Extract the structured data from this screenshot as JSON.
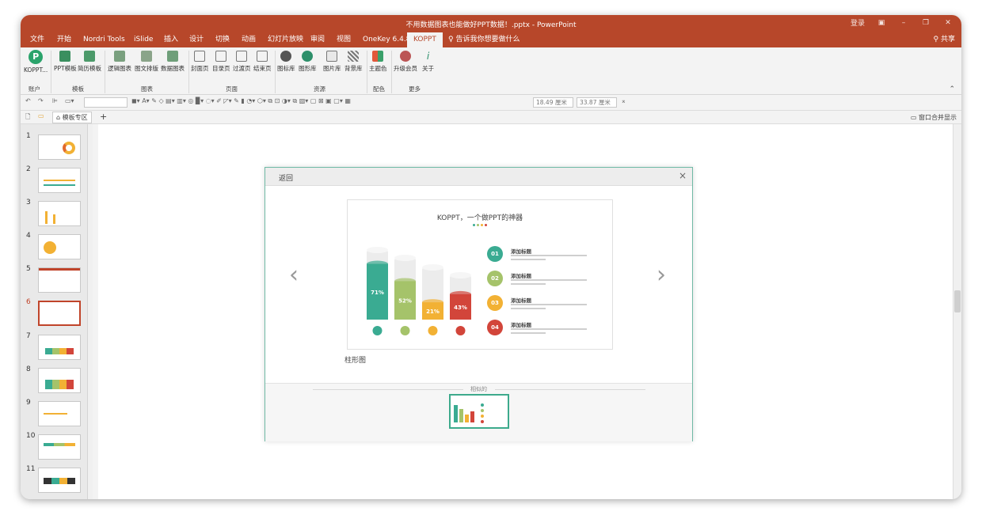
{
  "window": {
    "title": "不用数据图表也能做好PPT数据！.pptx - PowerPoint",
    "signin": "登录",
    "share": "共享"
  },
  "tabs": [
    {
      "label": "文件"
    },
    {
      "label": "开始"
    },
    {
      "label": "Nordri Tools"
    },
    {
      "label": "iSlide"
    },
    {
      "label": "插入"
    },
    {
      "label": "设计"
    },
    {
      "label": "切换"
    },
    {
      "label": "动画"
    },
    {
      "label": "幻灯片放映"
    },
    {
      "label": "审阅"
    },
    {
      "label": "视图"
    },
    {
      "label": "OneKey 6.4.8"
    },
    {
      "label": "KOPPT"
    }
  ],
  "tell_me": "告诉我你想要做什么",
  "ribbon": {
    "buttons": [
      "KOPPT...",
      "PPT模板",
      "简历模板",
      "逻辑图表",
      "图文排版",
      "数据图表",
      "封面页",
      "目录页",
      "过渡页",
      "结束页",
      "图标库",
      "图形库",
      "图片库",
      "背景库",
      "主题色",
      "升级会员",
      "关于"
    ],
    "groups": [
      "账户",
      "模板",
      "图表",
      "页面",
      "资源",
      "配色",
      "更多"
    ]
  },
  "toolbar": {
    "width": "18.49 厘米",
    "height": "33.87 厘米"
  },
  "tabrow": {
    "template_zone": "模板专区",
    "add": "+",
    "merge_window": "窗口合并显示"
  },
  "slides": [
    {
      "num": "1"
    },
    {
      "num": "2"
    },
    {
      "num": "3"
    },
    {
      "num": "4"
    },
    {
      "num": "5"
    },
    {
      "num": "6"
    },
    {
      "num": "7"
    },
    {
      "num": "8"
    },
    {
      "num": "9"
    },
    {
      "num": "10"
    },
    {
      "num": "11"
    }
  ],
  "active_slide": "6",
  "dialog": {
    "back": "返回",
    "close": "×",
    "preview_title": "KOPPT，一个做PPT的神器",
    "caption": "柱形图",
    "related_label": "相似的",
    "prev": "‹",
    "next": "›"
  },
  "preview_chart": {
    "bars": [
      {
        "label": "71%",
        "value": 71,
        "color": "#3aab92"
      },
      {
        "label": "52%",
        "value": 52,
        "color": "#a5c36a"
      },
      {
        "label": "21%",
        "value": 21,
        "color": "#f2b134"
      },
      {
        "label": "43%",
        "value": 43,
        "color": "#d2453a"
      }
    ],
    "items": [
      {
        "num": "01",
        "title": "添加标题",
        "color": "#3aab92"
      },
      {
        "num": "02",
        "title": "添加标题",
        "color": "#a5c36a"
      },
      {
        "num": "03",
        "title": "添加标题",
        "color": "#f2b134"
      },
      {
        "num": "04",
        "title": "添加标题",
        "color": "#d2453a"
      }
    ]
  },
  "colors": {
    "accent": "#b7472a",
    "teal": "#3daa8c"
  }
}
